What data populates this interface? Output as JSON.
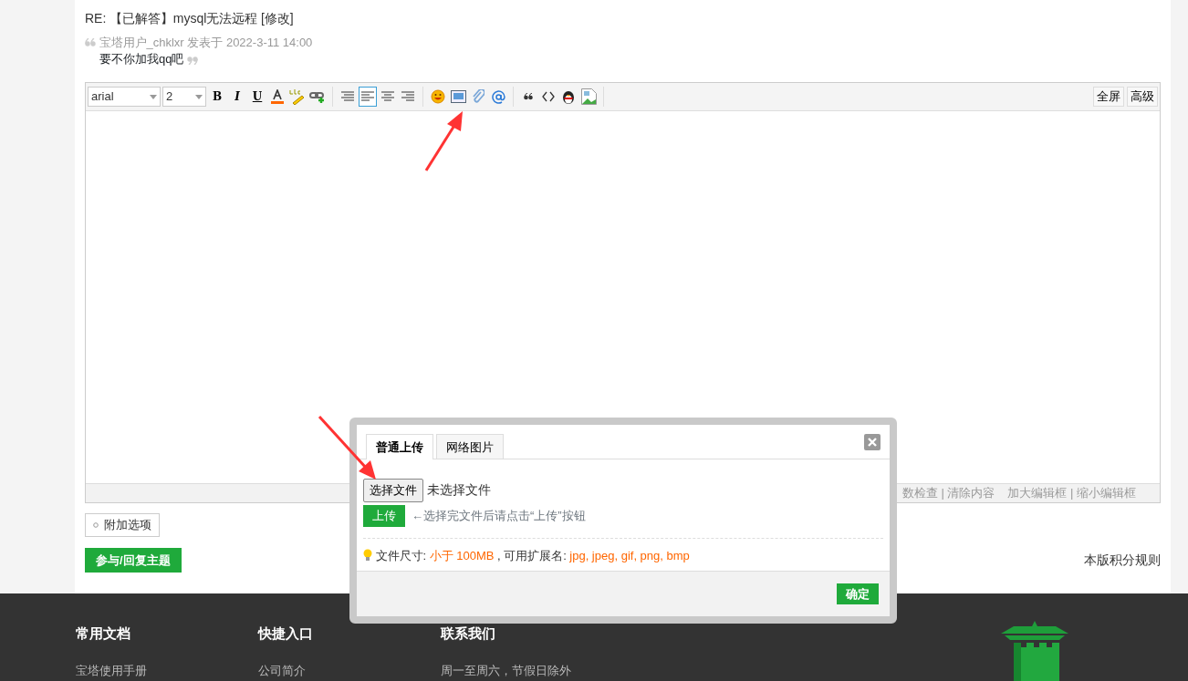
{
  "post": {
    "title_prefix": "RE:",
    "title": "【已解答】mysql无法远程",
    "edit_link": "[修改]"
  },
  "quote": {
    "meta": "宝塔用户_chklxr 发表于 2022-3-11 14:00",
    "text": "要不你加我qq吧"
  },
  "editor": {
    "font": "arial",
    "size": "2",
    "format_buttons": [
      {
        "kind": "bold",
        "label": "B"
      },
      {
        "kind": "italic",
        "label": "I"
      },
      {
        "kind": "underline",
        "label": "U"
      },
      {
        "kind": "color"
      },
      {
        "kind": "spell"
      },
      {
        "kind": "link"
      }
    ],
    "align_buttons": [
      {
        "kind": "justify",
        "selected": false
      },
      {
        "kind": "left",
        "selected": true
      },
      {
        "kind": "center",
        "selected": false
      },
      {
        "kind": "right",
        "selected": false
      }
    ],
    "insert_buttons": [
      {
        "kind": "smiley"
      },
      {
        "kind": "image"
      },
      {
        "kind": "attachment"
      },
      {
        "kind": "at"
      }
    ],
    "extra_buttons": [
      {
        "kind": "quote"
      },
      {
        "kind": "code"
      },
      {
        "kind": "penguin"
      },
      {
        "kind": "broken-image"
      }
    ],
    "right_buttons": [
      "全屏",
      "高级"
    ],
    "status_links": [
      "数检查 | 清除内容",
      "加大编辑框 | 缩小编辑框"
    ]
  },
  "attach_option": "附加选项",
  "reply_button": "参与/回复主题",
  "credits_link": "本版积分规则",
  "dialog": {
    "tabs": [
      {
        "label": "普通上传",
        "selected": true
      },
      {
        "label": "网络图片",
        "selected": false
      }
    ],
    "choose_file": "选择文件",
    "no_file": "未选择文件",
    "upload": "上传",
    "upload_hint": "←选择完文件后请点击“上传”按钮",
    "size_label": "文件尺寸:",
    "size_value": "小于 100MB",
    "ext_label": ", 可用扩展名:",
    "ext_value": "jpg, jpeg, gif, png, bmp",
    "confirm": "确定"
  },
  "footer": [
    {
      "heading": "常用文档",
      "items": [
        "宝塔使用手册"
      ]
    },
    {
      "heading": "快捷入口",
      "items": [
        "公司简介"
      ]
    },
    {
      "heading": "联系我们",
      "items": [
        "周一至周六，节假日除外"
      ]
    }
  ]
}
